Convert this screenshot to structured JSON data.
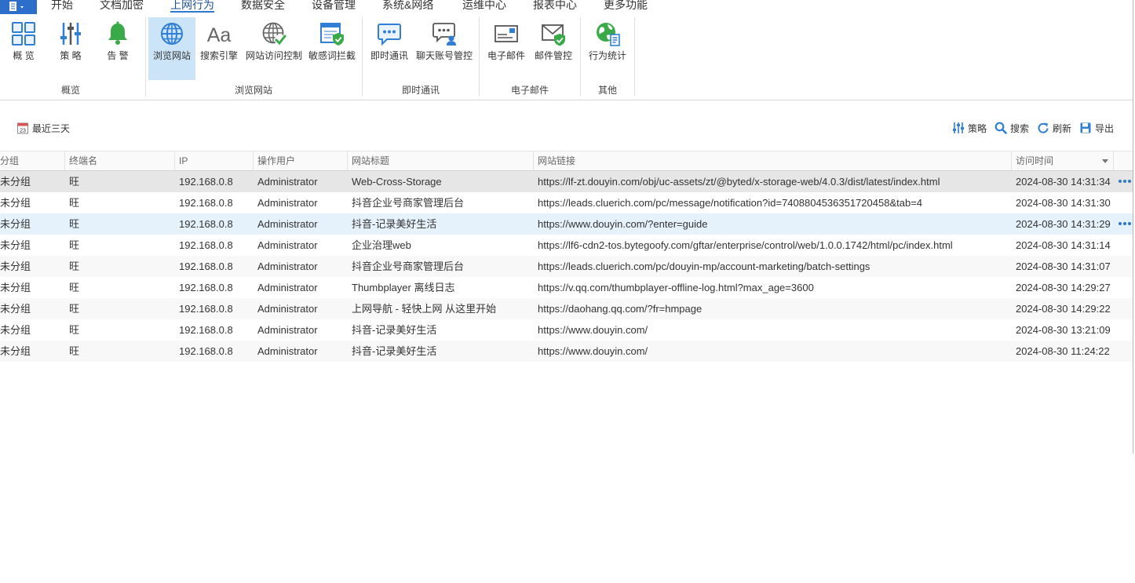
{
  "app_menu": {
    "icon": "document-menu-icon"
  },
  "menu": {
    "items": [
      {
        "label": "开始"
      },
      {
        "label": "文档加密"
      },
      {
        "label": "上网行为",
        "active": true
      },
      {
        "label": "数据安全"
      },
      {
        "label": "设备管理"
      },
      {
        "label": "系统&网络"
      },
      {
        "label": "运维中心"
      },
      {
        "label": "报表中心"
      },
      {
        "label": "更多功能"
      }
    ]
  },
  "ribbon": {
    "groups": [
      {
        "label": "概览",
        "items": [
          {
            "label": "概 览",
            "icon": "overview-grid-icon"
          },
          {
            "label": "策 略",
            "icon": "policy-sliders-icon"
          },
          {
            "label": "告 警",
            "icon": "alarm-bell-icon"
          }
        ]
      },
      {
        "label": "浏览网站",
        "items": [
          {
            "label": "浏览网站",
            "icon": "globe-icon",
            "active": true
          },
          {
            "label": "搜索引擎",
            "icon": "font-aa-icon",
            "icon_glyph": "Aa"
          },
          {
            "label": "网站访问控制",
            "icon": "globe-check-icon"
          },
          {
            "label": "敏感词拦截",
            "icon": "window-shield-icon"
          }
        ]
      },
      {
        "label": "即时通讯",
        "items": [
          {
            "label": "即时通讯",
            "icon": "chat-bubble-icon"
          },
          {
            "label": "聊天账号管控",
            "icon": "chat-account-icon"
          }
        ]
      },
      {
        "label": "电子邮件",
        "items": [
          {
            "label": "电子邮件",
            "icon": "mail-card-icon"
          },
          {
            "label": "邮件管控",
            "icon": "mail-shield-icon"
          }
        ]
      },
      {
        "label": "其他",
        "items": [
          {
            "label": "行为统计",
            "icon": "globe-stats-icon"
          }
        ]
      }
    ]
  },
  "toolbar": {
    "date_filter": {
      "label": "最近三天",
      "icon": "calendar-icon",
      "icon_glyph": "23"
    },
    "actions": [
      {
        "label": "策略",
        "icon": "sliders-icon"
      },
      {
        "label": "搜索",
        "icon": "search-icon"
      },
      {
        "label": "刷新",
        "icon": "refresh-icon"
      },
      {
        "label": "导出",
        "icon": "save-icon"
      }
    ]
  },
  "table": {
    "columns": [
      "分组",
      "终端名",
      "IP",
      "操作用户",
      "网站标题",
      "网站链接",
      "访问时间"
    ],
    "sort": {
      "column": "访问时间",
      "direction": "desc",
      "icon": "sort-desc-icon"
    },
    "selected_row": 0,
    "hover_row": 2,
    "rows": [
      {
        "group": "未分组",
        "terminal": "旺",
        "ip": "192.168.0.8",
        "user": "Administrator",
        "title": "Web-Cross-Storage",
        "url": "https://lf-zt.douyin.com/obj/uc-assets/zt/@byted/x-storage-web/4.0.3/dist/latest/index.html",
        "time": "2024-08-30 14:31:34",
        "show_more": true
      },
      {
        "group": "未分组",
        "terminal": "旺",
        "ip": "192.168.0.8",
        "user": "Administrator",
        "title": "抖音企业号商家管理后台",
        "url": "https://leads.cluerich.com/pc/message/notification?id=7408804536351720458&tab=4",
        "time": "2024-08-30 14:31:30",
        "show_more": false
      },
      {
        "group": "未分组",
        "terminal": "旺",
        "ip": "192.168.0.8",
        "user": "Administrator",
        "title": "抖音-记录美好生活",
        "url": "https://www.douyin.com/?enter=guide",
        "time": "2024-08-30 14:31:29",
        "show_more": true
      },
      {
        "group": "未分组",
        "terminal": "旺",
        "ip": "192.168.0.8",
        "user": "Administrator",
        "title": "企业治理web",
        "url": "https://lf6-cdn2-tos.bytegoofy.com/gftar/enterprise/control/web/1.0.0.1742/html/pc/index.html",
        "time": "2024-08-30 14:31:14",
        "show_more": false
      },
      {
        "group": "未分组",
        "terminal": "旺",
        "ip": "192.168.0.8",
        "user": "Administrator",
        "title": "抖音企业号商家管理后台",
        "url": "https://leads.cluerich.com/pc/douyin-mp/account-marketing/batch-settings",
        "time": "2024-08-30 14:31:07",
        "show_more": false
      },
      {
        "group": "未分组",
        "terminal": "旺",
        "ip": "192.168.0.8",
        "user": "Administrator",
        "title": "Thumbplayer 离线日志",
        "url": "https://v.qq.com/thumbplayer-offline-log.html?max_age=3600",
        "time": "2024-08-30 14:29:27",
        "show_more": false
      },
      {
        "group": "未分组",
        "terminal": "旺",
        "ip": "192.168.0.8",
        "user": "Administrator",
        "title": "上网导航 - 轻快上网 从这里开始",
        "url": "https://daohang.qq.com/?fr=hmpage",
        "time": "2024-08-30 14:29:22",
        "show_more": false
      },
      {
        "group": "未分组",
        "terminal": "旺",
        "ip": "192.168.0.8",
        "user": "Administrator",
        "title": "抖音-记录美好生活",
        "url": "https://www.douyin.com/",
        "time": "2024-08-30 13:21:09",
        "show_more": false
      },
      {
        "group": "未分组",
        "terminal": "旺",
        "ip": "192.168.0.8",
        "user": "Administrator",
        "title": "抖音-记录美好生活",
        "url": "https://www.douyin.com/",
        "time": "2024-08-30 11:24:22",
        "show_more": false
      }
    ]
  },
  "colors": {
    "accent": "#2b79d0",
    "app_button": "#2c6ec9",
    "ribbon_active": "#cce4f7",
    "row_selected": "#e6e6e6",
    "row_hover": "#e5f1fb",
    "icon_blue": "#2f7fd6",
    "icon_green": "#3aaa48"
  }
}
